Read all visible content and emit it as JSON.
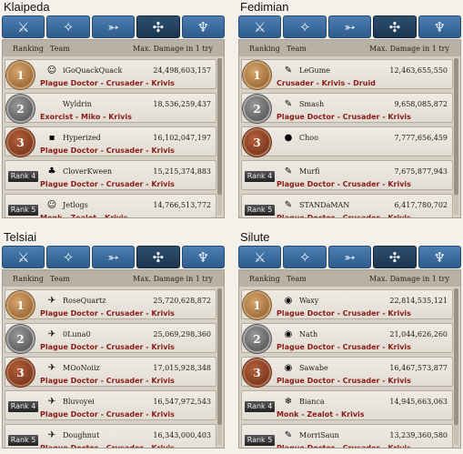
{
  "tab_icons": [
    "sword-icon",
    "magic-staff-icon",
    "bow-icon",
    "cross-icon",
    "cleric-icon"
  ],
  "header": {
    "ranking": "Ranking",
    "team": "Team",
    "max_damage": "Max. Damage in 1 try"
  },
  "panels": [
    {
      "server": "Klaipeda",
      "rows": [
        {
          "rank": "1",
          "name": "iGoQuackQuack",
          "damage": "24,498,603,157",
          "classes": "Plague Doctor - Crusader - Krivis",
          "icon": "☺"
        },
        {
          "rank": "2",
          "name": "Wyldrin",
          "damage": "18,536,259,437",
          "classes": "Exorcist - Miko - Krivis",
          "icon": ""
        },
        {
          "rank": "3",
          "name": "Hyperized",
          "damage": "16,102,047,197",
          "classes": "Plague Doctor - Crusader - Krivis",
          "icon": "▪"
        },
        {
          "rank": "Rank 4",
          "name": "CloverKween",
          "damage": "15,215,374,883",
          "classes": "Plague Doctor - Crusader - Krivis",
          "icon": "♣"
        },
        {
          "rank": "Rank 5",
          "name": "Jetlogs",
          "damage": "14,766,513,772",
          "classes": "Monk - Zealot - Krivis",
          "icon": "☺"
        }
      ]
    },
    {
      "server": "Fedimian",
      "rows": [
        {
          "rank": "1",
          "name": "LeGume",
          "damage": "12,463,655,550",
          "classes": "Crusader - Krivis - Druid",
          "icon": "✎"
        },
        {
          "rank": "2",
          "name": "Smash",
          "damage": "9,658,085,872",
          "classes": "Plague Doctor - Crusader - Krivis",
          "icon": "✎"
        },
        {
          "rank": "3",
          "name": "Choo",
          "damage": "7,777,656,459",
          "classes": "",
          "icon": "●"
        },
        {
          "rank": "Rank 4",
          "name": "Murfi",
          "damage": "7,675,877,943",
          "classes": "Plague Doctor - Crusader - Krivis",
          "icon": "✎"
        },
        {
          "rank": "Rank 5",
          "name": "STANDaMAN",
          "damage": "6,417,780,702",
          "classes": "Plague Doctor - Crusader - Krivis",
          "icon": "✎"
        }
      ]
    },
    {
      "server": "Telsiai",
      "rows": [
        {
          "rank": "1",
          "name": "RoseQuartz",
          "damage": "25,720,628,872",
          "classes": "Plague Doctor - Crusader - Krivis",
          "icon": "✈"
        },
        {
          "rank": "2",
          "name": "0Luna0",
          "damage": "25,069,298,360",
          "classes": "Plague Doctor - Crusader - Krivis",
          "icon": "✈"
        },
        {
          "rank": "3",
          "name": "MOoNoiiz",
          "damage": "17,015,928,348",
          "classes": "Plague Doctor - Crusader - Krivis",
          "icon": "✈"
        },
        {
          "rank": "Rank 4",
          "name": "Bluvoyei",
          "damage": "16,547,972,543",
          "classes": "Plague Doctor - Crusader - Krivis",
          "icon": "✈"
        },
        {
          "rank": "Rank 5",
          "name": "Doughnut",
          "damage": "16,343,000,403",
          "classes": "Plague Doctor - Crusader - Krivis",
          "icon": "✈"
        }
      ]
    },
    {
      "server": "Silute",
      "rows": [
        {
          "rank": "1",
          "name": "Waxy",
          "damage": "22,814,535,121",
          "classes": "Plague Doctor - Crusader - Krivis",
          "icon": "◉"
        },
        {
          "rank": "2",
          "name": "Nath",
          "damage": "21,044,626,260",
          "classes": "Plague Doctor - Crusader - Krivis",
          "icon": "◉"
        },
        {
          "rank": "3",
          "name": "Sawabe",
          "damage": "16,467,573,877",
          "classes": "Plague Doctor - Crusader - Krivis",
          "icon": "◉"
        },
        {
          "rank": "Rank 4",
          "name": "Bianca",
          "damage": "14,945,663,063",
          "classes": "Monk - Zealot - Krivis",
          "icon": "❄"
        },
        {
          "rank": "Rank 5",
          "name": "MorriSaun",
          "damage": "13,239,360,580",
          "classes": "Plague Doctor - Crusader - Krivis",
          "icon": "✎"
        }
      ]
    }
  ]
}
